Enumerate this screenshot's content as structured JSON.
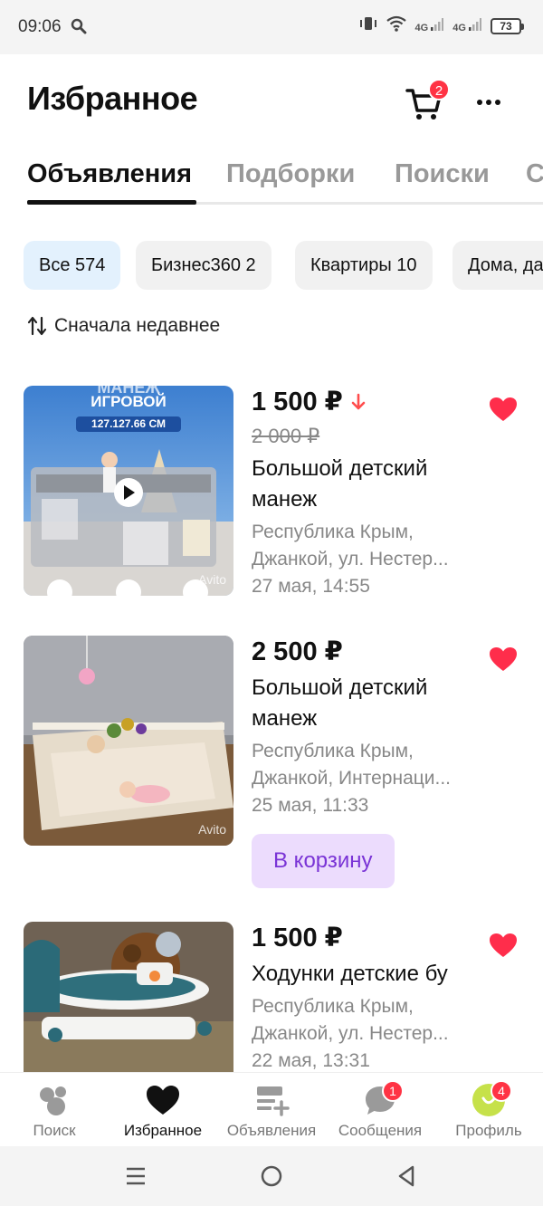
{
  "status_bar": {
    "time": "09:06",
    "network_1": "4G",
    "network_2": "4G",
    "battery": "73"
  },
  "header": {
    "title": "Избранное",
    "cart_count": "2"
  },
  "tabs": [
    {
      "label": "Объявления",
      "active": true
    },
    {
      "label": "Подборки",
      "active": false
    },
    {
      "label": "Поиски",
      "active": false
    },
    {
      "label": "Сравнения",
      "active": false
    }
  ],
  "chips": [
    {
      "label": "Все 574",
      "active": true
    },
    {
      "label": "Бизнес360 2",
      "active": false
    },
    {
      "label": "Квартиры 10",
      "active": false
    },
    {
      "label": "Дома, дачи",
      "active": false
    }
  ],
  "sort": {
    "label": "Сначала недавнее"
  },
  "listings": [
    {
      "price": "1 500 ₽",
      "old_price": "2 000 ₽",
      "price_down": true,
      "title": "Большой детский манеж",
      "address_line1": "Республика Крым,",
      "address_line2": "Джанкой, ул. Нестер...",
      "date": "27 мая, 14:55",
      "image_overlay": {
        "line1": "МАНЕЖ",
        "line2": "ИГРОВОЙ",
        "size": "127.127.66 СМ",
        "watermark": "Avito"
      }
    },
    {
      "price": "2 500 ₽",
      "title": "Большой детский манеж",
      "address_line1": "Республика Крым,",
      "address_line2": "Джанкой, Интернаци...",
      "date": "25 мая, 11:33",
      "cart_button": "В корзину",
      "image_overlay": {
        "watermark": "Avito"
      }
    },
    {
      "price": "1 500 ₽",
      "title": "Ходунки детские бу",
      "address_line1": "Республика Крым,",
      "address_line2": "Джанкой, ул. Нестер...",
      "date": "22 мая, 13:31"
    }
  ],
  "bottom_nav": [
    {
      "label": "Поиск",
      "icon": "search-bubbles-icon",
      "active": false
    },
    {
      "label": "Избранное",
      "icon": "heart-icon",
      "active": true
    },
    {
      "label": "Объявления",
      "icon": "ads-icon",
      "active": false
    },
    {
      "label": "Сообщения",
      "icon": "chat-icon",
      "active": false,
      "badge": "1"
    },
    {
      "label": "Профиль",
      "icon": "profile-icon",
      "active": false,
      "badge": "4"
    }
  ],
  "colors": {
    "accent_red": "#ff3344",
    "heart": "#ff2d4b",
    "chip_active": "#e3f1fd",
    "cart_button_bg": "#ecdcfd",
    "cart_button_text": "#7a34d6"
  }
}
